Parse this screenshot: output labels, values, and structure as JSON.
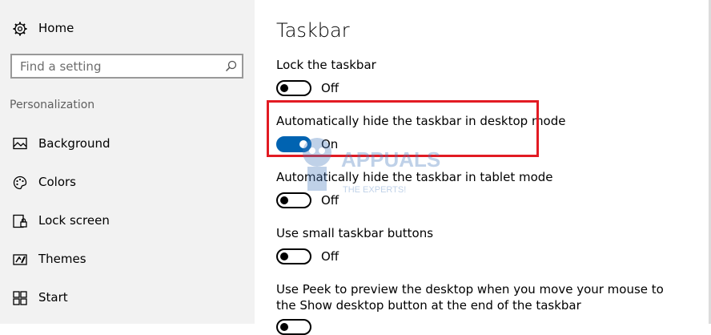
{
  "sidebar": {
    "home_label": "Home",
    "search_placeholder": "Find a setting",
    "section_label": "Personalization",
    "items": [
      {
        "label": "Background",
        "icon": "image-icon"
      },
      {
        "label": "Colors",
        "icon": "palette-icon"
      },
      {
        "label": "Lock screen",
        "icon": "lock-screen-icon"
      },
      {
        "label": "Themes",
        "icon": "themes-icon"
      },
      {
        "label": "Start",
        "icon": "start-icon"
      }
    ]
  },
  "main": {
    "title": "Taskbar",
    "settings": [
      {
        "label": "Lock the taskbar",
        "state": "Off",
        "on": false
      },
      {
        "label": "Automatically hide the taskbar in desktop mode",
        "state": "On",
        "on": true
      },
      {
        "label": "Automatically hide the taskbar in tablet mode",
        "state": "Off",
        "on": false
      },
      {
        "label": "Use small taskbar buttons",
        "state": "Off",
        "on": false
      },
      {
        "label_line1": "Use Peek to preview the desktop when you move your mouse to",
        "label_line2": "the Show desktop button at the end of the taskbar"
      }
    ]
  },
  "watermark": {
    "brand": "APPUALS",
    "tagline": "THE EXPERTS!"
  },
  "colors": {
    "accent": "#0063b1",
    "highlight": "#e21b23",
    "sidebar_bg": "#f2f2f2"
  }
}
